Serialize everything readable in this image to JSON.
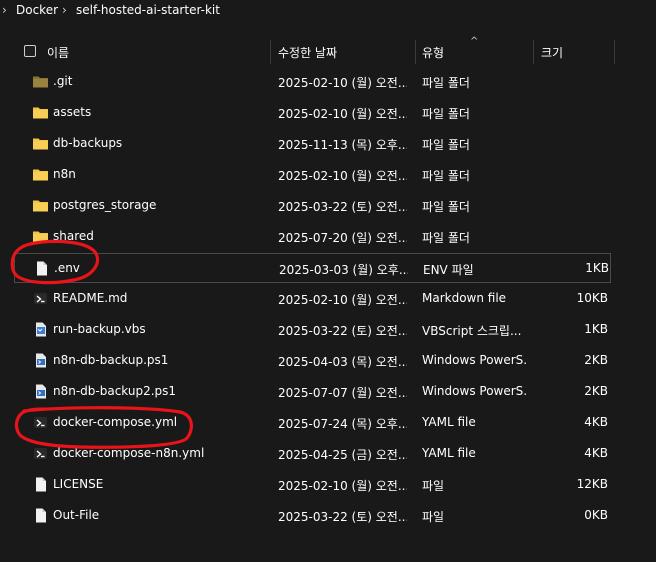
{
  "breadcrumb": {
    "items": [
      "Docker",
      "self-hosted-ai-starter-kit"
    ],
    "separator": "›"
  },
  "columns": {
    "name": "이름",
    "date": "수정한 날짜",
    "type": "유형",
    "size": "크기"
  },
  "files": [
    {
      "name": ".git",
      "date": "2025-02-10 (월) 오전...",
      "type": "파일 폴더",
      "size": "",
      "icon": "folder-dim-icon"
    },
    {
      "name": "assets",
      "date": "2025-02-10 (월) 오전...",
      "type": "파일 폴더",
      "size": "",
      "icon": "folder-icon"
    },
    {
      "name": "db-backups",
      "date": "2025-11-13 (목) 오후...",
      "type": "파일 폴더",
      "size": "",
      "icon": "folder-icon"
    },
    {
      "name": "n8n",
      "date": "2025-02-10 (월) 오전...",
      "type": "파일 폴더",
      "size": "",
      "icon": "folder-icon"
    },
    {
      "name": "postgres_storage",
      "date": "2025-03-22 (토) 오전...",
      "type": "파일 폴더",
      "size": "",
      "icon": "folder-icon"
    },
    {
      "name": "shared",
      "date": "2025-07-20 (일) 오전...",
      "type": "파일 폴더",
      "size": "",
      "icon": "folder-icon"
    },
    {
      "name": ".env",
      "date": "2025-03-03 (월) 오후...",
      "type": "ENV 파일",
      "size": "1KB",
      "icon": "file-icon"
    },
    {
      "name": "README.md",
      "date": "2025-02-10 (월) 오전...",
      "type": "Markdown file",
      "size": "10KB",
      "icon": "markdown-file-icon"
    },
    {
      "name": "run-backup.vbs",
      "date": "2025-03-22 (토) 오전...",
      "type": "VBScript 스크립...",
      "size": "1KB",
      "icon": "vbscript-file-icon"
    },
    {
      "name": "n8n-db-backup.ps1",
      "date": "2025-04-03 (목) 오전...",
      "type": "Windows PowerS...",
      "size": "2KB",
      "icon": "powershell-file-icon"
    },
    {
      "name": "n8n-db-backup2.ps1",
      "date": "2025-07-07 (월) 오전...",
      "type": "Windows PowerS...",
      "size": "2KB",
      "icon": "powershell-file-icon"
    },
    {
      "name": "docker-compose.yml",
      "date": "2025-07-24 (목) 오후...",
      "type": "YAML file",
      "size": "4KB",
      "icon": "yaml-file-icon"
    },
    {
      "name": "docker-compose-n8n.yml",
      "date": "2025-04-25 (금) 오전...",
      "type": "YAML file",
      "size": "4KB",
      "icon": "yaml-file-icon"
    },
    {
      "name": "LICENSE",
      "date": "2025-02-10 (월) 오전...",
      "type": "파일",
      "size": "12KB",
      "icon": "file-icon"
    },
    {
      "name": "Out-File",
      "date": "2025-03-22 (토) 오전...",
      "type": "파일",
      "size": "0KB",
      "icon": "file-icon"
    }
  ],
  "colors": {
    "background": "#191919",
    "folder": "#f5c242",
    "annotation": "#e8141a"
  }
}
